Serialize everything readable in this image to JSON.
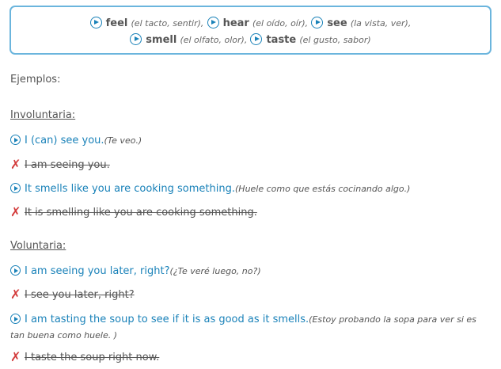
{
  "verbs": [
    {
      "word": "feel",
      "translation": "(el tacto, sentir),"
    },
    {
      "word": "hear",
      "translation": "(el oído, oír),"
    },
    {
      "word": "see",
      "translation": "(la vista, ver),"
    },
    {
      "word": "smell",
      "translation": "(el olfato, olor),"
    },
    {
      "word": "taste",
      "translation": "(el gusto, sabor)"
    }
  ],
  "examples_label": "Ejemplos:",
  "involuntary": {
    "heading": "Involuntaria:",
    "good1": {
      "text": "I (can) see you.",
      "note": "(Te veo.)"
    },
    "bad1": "I am seeing you.",
    "good2": {
      "text": "It smells like you are cooking something.",
      "note": "(Huele como que estás cocinando algo.)"
    },
    "bad2": "It is smelling like you are cooking something."
  },
  "voluntary": {
    "heading": "Voluntaria:",
    "good1": {
      "text": "I am seeing you later, right?",
      "note": "(¿Te veré luego, no?)"
    },
    "bad1": "I see you later, right?",
    "good2": {
      "text": "I am tasting the soup to see if it is as good as it smells.",
      "note": "(Estoy probando la sopa para ver si es tan buena como huele. )"
    },
    "bad2": "I taste the soup right now."
  },
  "colors": {
    "accent": "#1a82b9",
    "border": "#6bb5dd",
    "wrong": "#d33a3a"
  },
  "icons": {
    "audio": "play-circle-icon",
    "wrong": "red-x-icon"
  }
}
